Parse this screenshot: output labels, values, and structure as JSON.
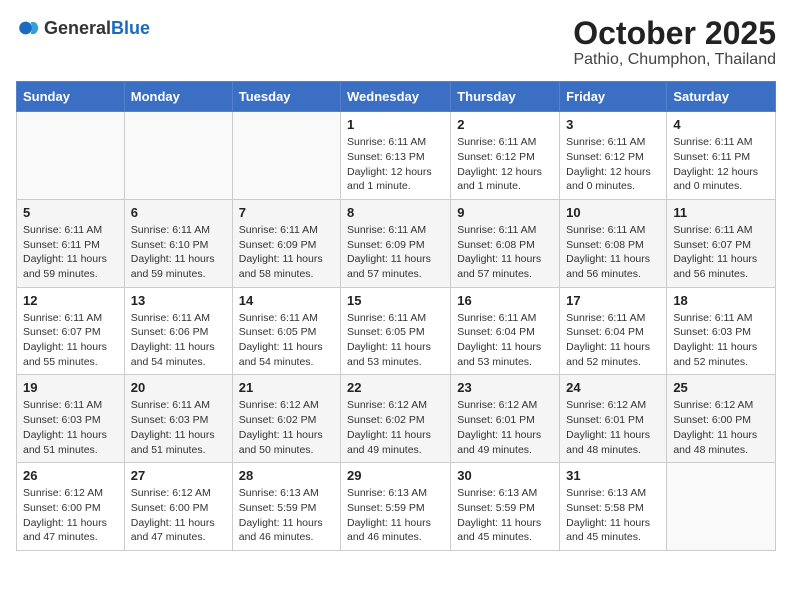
{
  "header": {
    "logo_general": "General",
    "logo_blue": "Blue",
    "title": "October 2025",
    "subtitle": "Pathio, Chumphon, Thailand"
  },
  "calendar": {
    "weekdays": [
      "Sunday",
      "Monday",
      "Tuesday",
      "Wednesday",
      "Thursday",
      "Friday",
      "Saturday"
    ],
    "weeks": [
      [
        {
          "day": "",
          "info": ""
        },
        {
          "day": "",
          "info": ""
        },
        {
          "day": "",
          "info": ""
        },
        {
          "day": "1",
          "info": "Sunrise: 6:11 AM\nSunset: 6:13 PM\nDaylight: 12 hours\nand 1 minute."
        },
        {
          "day": "2",
          "info": "Sunrise: 6:11 AM\nSunset: 6:12 PM\nDaylight: 12 hours\nand 1 minute."
        },
        {
          "day": "3",
          "info": "Sunrise: 6:11 AM\nSunset: 6:12 PM\nDaylight: 12 hours\nand 0 minutes."
        },
        {
          "day": "4",
          "info": "Sunrise: 6:11 AM\nSunset: 6:11 PM\nDaylight: 12 hours\nand 0 minutes."
        }
      ],
      [
        {
          "day": "5",
          "info": "Sunrise: 6:11 AM\nSunset: 6:11 PM\nDaylight: 11 hours\nand 59 minutes."
        },
        {
          "day": "6",
          "info": "Sunrise: 6:11 AM\nSunset: 6:10 PM\nDaylight: 11 hours\nand 59 minutes."
        },
        {
          "day": "7",
          "info": "Sunrise: 6:11 AM\nSunset: 6:09 PM\nDaylight: 11 hours\nand 58 minutes."
        },
        {
          "day": "8",
          "info": "Sunrise: 6:11 AM\nSunset: 6:09 PM\nDaylight: 11 hours\nand 57 minutes."
        },
        {
          "day": "9",
          "info": "Sunrise: 6:11 AM\nSunset: 6:08 PM\nDaylight: 11 hours\nand 57 minutes."
        },
        {
          "day": "10",
          "info": "Sunrise: 6:11 AM\nSunset: 6:08 PM\nDaylight: 11 hours\nand 56 minutes."
        },
        {
          "day": "11",
          "info": "Sunrise: 6:11 AM\nSunset: 6:07 PM\nDaylight: 11 hours\nand 56 minutes."
        }
      ],
      [
        {
          "day": "12",
          "info": "Sunrise: 6:11 AM\nSunset: 6:07 PM\nDaylight: 11 hours\nand 55 minutes."
        },
        {
          "day": "13",
          "info": "Sunrise: 6:11 AM\nSunset: 6:06 PM\nDaylight: 11 hours\nand 54 minutes."
        },
        {
          "day": "14",
          "info": "Sunrise: 6:11 AM\nSunset: 6:05 PM\nDaylight: 11 hours\nand 54 minutes."
        },
        {
          "day": "15",
          "info": "Sunrise: 6:11 AM\nSunset: 6:05 PM\nDaylight: 11 hours\nand 53 minutes."
        },
        {
          "day": "16",
          "info": "Sunrise: 6:11 AM\nSunset: 6:04 PM\nDaylight: 11 hours\nand 53 minutes."
        },
        {
          "day": "17",
          "info": "Sunrise: 6:11 AM\nSunset: 6:04 PM\nDaylight: 11 hours\nand 52 minutes."
        },
        {
          "day": "18",
          "info": "Sunrise: 6:11 AM\nSunset: 6:03 PM\nDaylight: 11 hours\nand 52 minutes."
        }
      ],
      [
        {
          "day": "19",
          "info": "Sunrise: 6:11 AM\nSunset: 6:03 PM\nDaylight: 11 hours\nand 51 minutes."
        },
        {
          "day": "20",
          "info": "Sunrise: 6:11 AM\nSunset: 6:03 PM\nDaylight: 11 hours\nand 51 minutes."
        },
        {
          "day": "21",
          "info": "Sunrise: 6:12 AM\nSunset: 6:02 PM\nDaylight: 11 hours\nand 50 minutes."
        },
        {
          "day": "22",
          "info": "Sunrise: 6:12 AM\nSunset: 6:02 PM\nDaylight: 11 hours\nand 49 minutes."
        },
        {
          "day": "23",
          "info": "Sunrise: 6:12 AM\nSunset: 6:01 PM\nDaylight: 11 hours\nand 49 minutes."
        },
        {
          "day": "24",
          "info": "Sunrise: 6:12 AM\nSunset: 6:01 PM\nDaylight: 11 hours\nand 48 minutes."
        },
        {
          "day": "25",
          "info": "Sunrise: 6:12 AM\nSunset: 6:00 PM\nDaylight: 11 hours\nand 48 minutes."
        }
      ],
      [
        {
          "day": "26",
          "info": "Sunrise: 6:12 AM\nSunset: 6:00 PM\nDaylight: 11 hours\nand 47 minutes."
        },
        {
          "day": "27",
          "info": "Sunrise: 6:12 AM\nSunset: 6:00 PM\nDaylight: 11 hours\nand 47 minutes."
        },
        {
          "day": "28",
          "info": "Sunrise: 6:13 AM\nSunset: 5:59 PM\nDaylight: 11 hours\nand 46 minutes."
        },
        {
          "day": "29",
          "info": "Sunrise: 6:13 AM\nSunset: 5:59 PM\nDaylight: 11 hours\nand 46 minutes."
        },
        {
          "day": "30",
          "info": "Sunrise: 6:13 AM\nSunset: 5:59 PM\nDaylight: 11 hours\nand 45 minutes."
        },
        {
          "day": "31",
          "info": "Sunrise: 6:13 AM\nSunset: 5:58 PM\nDaylight: 11 hours\nand 45 minutes."
        },
        {
          "day": "",
          "info": ""
        }
      ]
    ]
  }
}
